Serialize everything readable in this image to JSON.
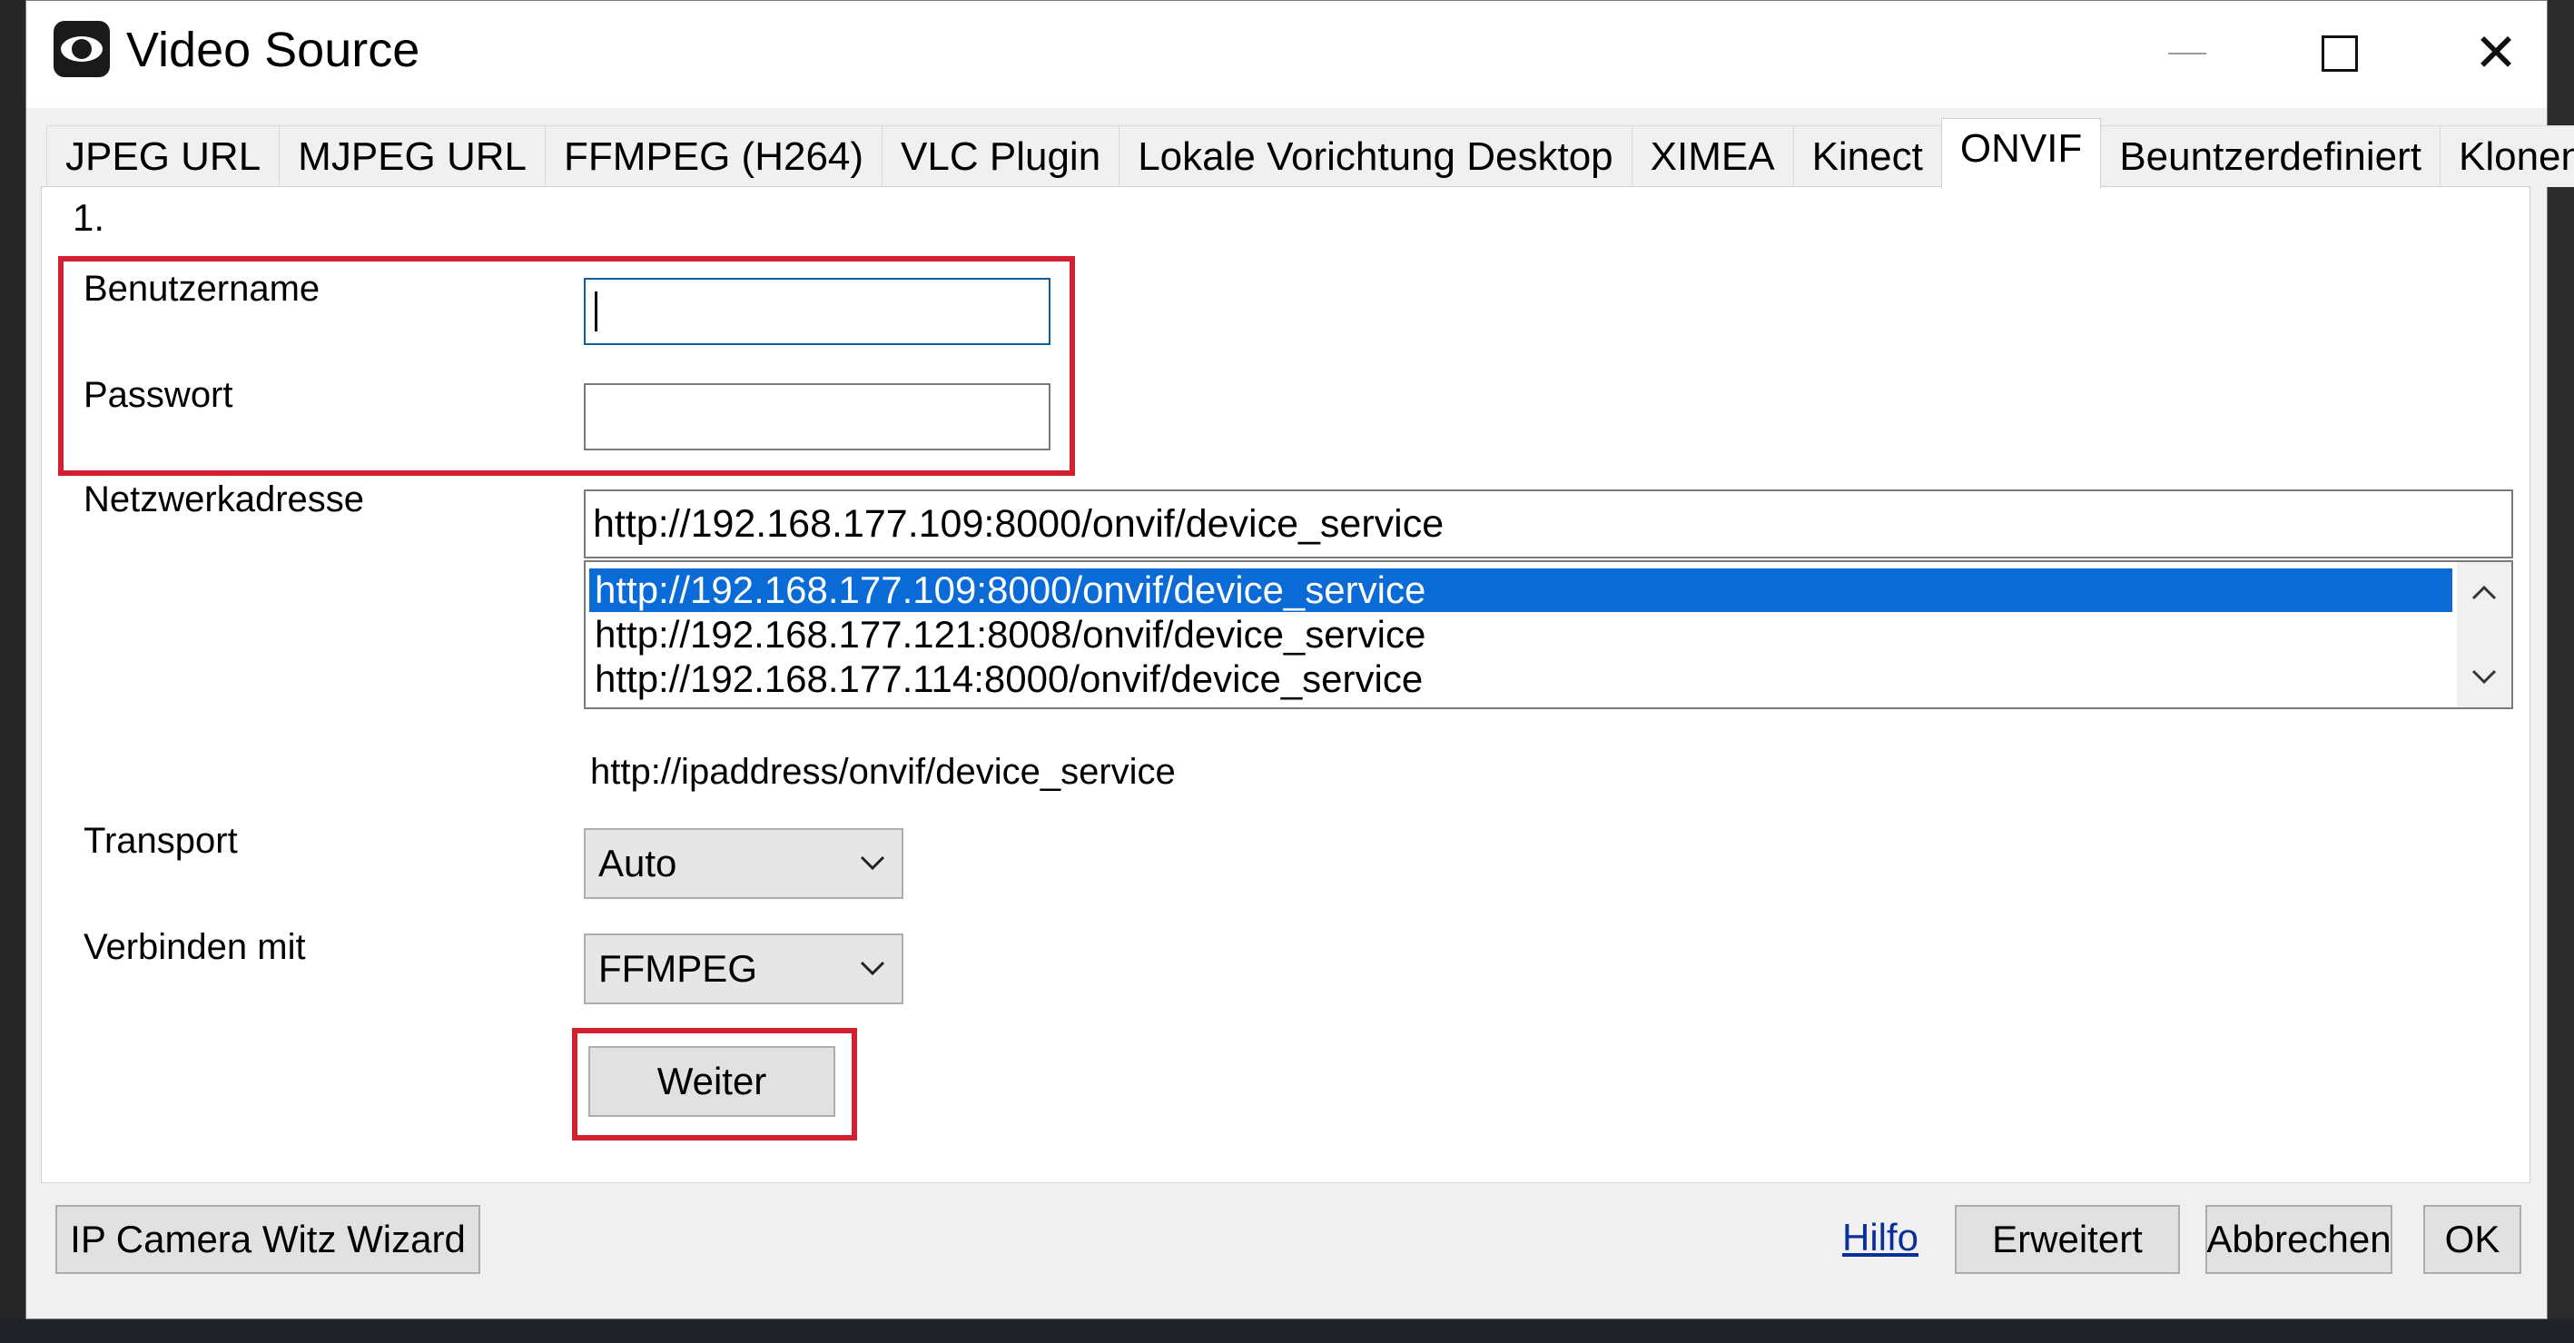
{
  "window": {
    "title": "Video Source"
  },
  "tabs": [
    {
      "label": "JPEG URL",
      "active": false
    },
    {
      "label": "MJPEG URL",
      "active": false
    },
    {
      "label": "FFMPEG (H264)",
      "active": false
    },
    {
      "label": "VLC Plugin",
      "active": false
    },
    {
      "label": "Lokale Vorichtung Desktop",
      "active": false
    },
    {
      "label": "XIMEA",
      "active": false
    },
    {
      "label": "Kinect",
      "active": false
    },
    {
      "label": "ONVIF",
      "active": true
    },
    {
      "label": "Beuntzerdefiniert",
      "active": false
    },
    {
      "label": "Klonen",
      "active": false
    }
  ],
  "onvif": {
    "step": "1.",
    "username_label": "Benutzername",
    "username_value": "",
    "password_label": "Passwort",
    "password_value": "",
    "address_label": "Netzwerkadresse",
    "address_value": "http://192.168.177.109:8000/onvif/device_service",
    "address_options": [
      {
        "text": "http://192.168.177.109:8000/onvif/device_service",
        "selected": true
      },
      {
        "text": "http://192.168.177.121:8008/onvif/device_service",
        "selected": false
      },
      {
        "text": "http://192.168.177.114:8000/onvif/device_service",
        "selected": false
      }
    ],
    "address_hint": "http://ipaddress/onvif/device_service",
    "transport_label": "Transport",
    "transport_value": "Auto",
    "connect_label": "Verbinden mit",
    "connect_value": "FFMPEG",
    "next_button": "Weiter"
  },
  "footer": {
    "wizard_button": "IP Camera Witz Wizard",
    "help_link": "Hilfo",
    "advanced_button": "Erweitert",
    "cancel_button": "Abbrechen",
    "ok_button": "OK"
  },
  "colors": {
    "highlight": "#d1202f",
    "selection": "#0a6ad6",
    "link": "#0b2e9a"
  }
}
